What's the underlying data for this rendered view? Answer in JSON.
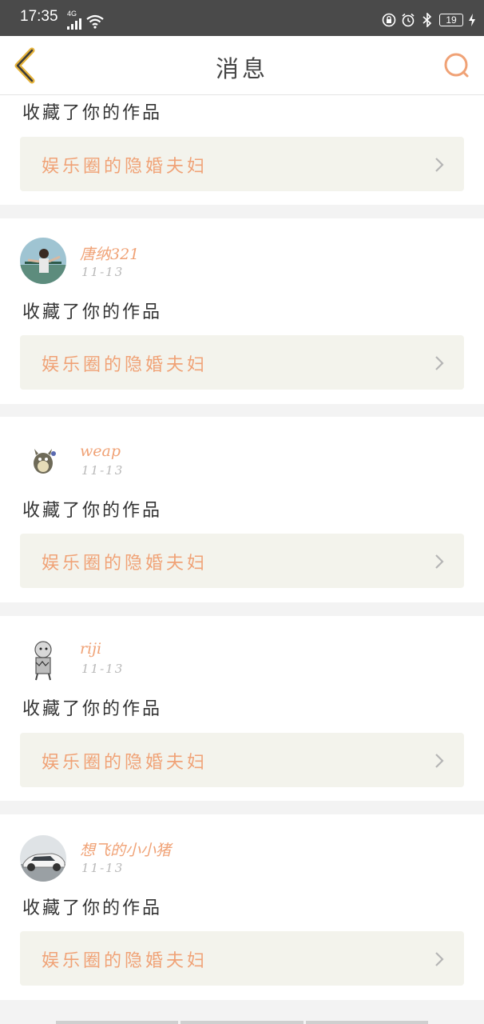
{
  "status_bar": {
    "time": "17:35",
    "network": "4G",
    "battery": "19"
  },
  "header": {
    "title": "消息"
  },
  "colors": {
    "accent": "#f0a276",
    "back_arrow": "#e6b33a",
    "box_bg": "#f3f3ec"
  },
  "notifications": [
    {
      "user": "",
      "date": "",
      "action": "收藏了你的作品",
      "work": "娱乐圈的隐婚夫妇"
    },
    {
      "user": "唐纳321",
      "date": "11-13",
      "action": "收藏了你的作品",
      "work": "娱乐圈的隐婚夫妇"
    },
    {
      "user": "weap",
      "date": "11-13",
      "action": "收藏了你的作品",
      "work": "娱乐圈的隐婚夫妇"
    },
    {
      "user": "riji",
      "date": "11-13",
      "action": "收藏了你的作品",
      "work": "娱乐圈的隐婚夫妇"
    },
    {
      "user": "想飞的小小猪",
      "date": "11-13",
      "action": "收藏了你的作品",
      "work": "娱乐圈的隐婚夫妇"
    }
  ]
}
